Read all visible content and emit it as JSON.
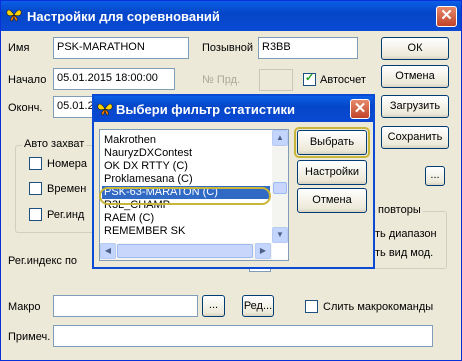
{
  "window": {
    "title": "Настройки для соревнований",
    "close_glyph": "✕"
  },
  "form": {
    "name_label": "Имя",
    "name_value": "PSK-MARATHON",
    "callsign_label": "Позывной",
    "callsign_value": "R3BB",
    "start_label": "Начало",
    "start_value": "05.01.2015 18:00:00",
    "prd_label": "№ Прд.",
    "autocount_label": "Автосчет",
    "end_label": "Оконч.",
    "end_value": "05.01.2",
    "auto_capture_label": "Авто захват",
    "chk_number": "Номера",
    "chk_time": "Времен",
    "chk_reg": "Рег.инд",
    "reg_index_label": "Рег.индекс по",
    "repeats_label": "повторы",
    "range_text": "ть диапазон",
    "mode_text": "ть вид мод.",
    "macro_label": "Макро",
    "macro_browse": "...",
    "macro_edit": "Ред...",
    "merge_macros_label": "Слить макрокоманды",
    "note_label": "Примеч.",
    "ellipsis": "..."
  },
  "buttons": {
    "ok": "ОК",
    "cancel": "Отмена",
    "load": "Загрузить",
    "save": "Сохранить"
  },
  "dialog": {
    "title": "Выбери фильтр статистики",
    "close_glyph": "✕",
    "items": [
      "Makrothen",
      "NauryzDXContest",
      "OK DX RTTY  (C)",
      "Proklamesana (C)",
      "PSK-63-MARATON (C)",
      "R3L_CHAMP",
      "RAEM (C)",
      "REMEMBER SK"
    ],
    "selected_index": 4,
    "select_button": "Выбрать",
    "settings_button": "Настройки",
    "cancel_button": "Отмена"
  },
  "colors": {
    "title_bar": "#0a4ad4",
    "selection": "#316ac5",
    "highlight_ring": "#c8b63a",
    "window_bg": "#ece9d8"
  },
  "icons": {
    "app": "butterfly-icon",
    "close": "close-icon"
  }
}
